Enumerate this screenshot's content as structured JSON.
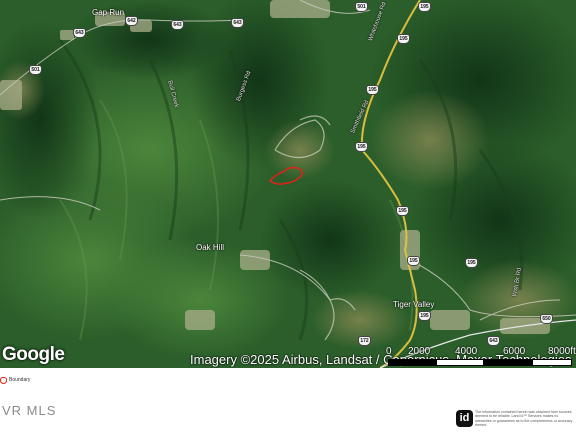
{
  "map": {
    "place_labels": [
      {
        "id": "gap-run",
        "text": "Gap Run"
      },
      {
        "id": "oak-hill",
        "text": "Oak Hill"
      },
      {
        "id": "tiger-valley",
        "text": "Tiger Valley"
      }
    ],
    "road_labels": [
      {
        "id": "whitehouse-rd",
        "text": "Whitehouse Rd"
      },
      {
        "id": "smithfield-rd",
        "text": "Smithfield Rd"
      },
      {
        "id": "bull-creek",
        "text": "Bull Creek"
      },
      {
        "id": "burgess-rd",
        "text": "Burgess Rd"
      },
      {
        "id": "wsh-br-rd",
        "text": "Wsh Br Rd"
      }
    ],
    "route_shields": [
      {
        "id": "s1",
        "text": "643"
      },
      {
        "id": "s2",
        "text": "642"
      },
      {
        "id": "s3",
        "text": "643"
      },
      {
        "id": "s4",
        "text": "643"
      },
      {
        "id": "s5",
        "text": "501"
      },
      {
        "id": "s6",
        "text": "501"
      },
      {
        "id": "s7",
        "text": "195"
      },
      {
        "id": "s8",
        "text": "195"
      },
      {
        "id": "s9",
        "text": "195"
      },
      {
        "id": "s10",
        "text": "195"
      },
      {
        "id": "s11",
        "text": "195"
      },
      {
        "id": "s12",
        "text": "195"
      },
      {
        "id": "s13",
        "text": "195"
      },
      {
        "id": "s14",
        "text": "195"
      },
      {
        "id": "s15",
        "text": "172"
      },
      {
        "id": "s16",
        "text": "643"
      },
      {
        "id": "s17",
        "text": "650"
      }
    ],
    "google_logo": "Google",
    "attribution": "Imagery ©2025 Airbus, Landsat / Copernicus, Maxar Technologies",
    "scale": {
      "labels": [
        "0",
        "2000",
        "4000",
        "6000",
        "8000ft"
      ]
    },
    "colors": {
      "forest_dark": "#1d4a22",
      "forest_mid": "#2f6b2d",
      "forest_light": "#4f8a3d",
      "clearing": "#9aa57a",
      "road_yellow": "#e3c240",
      "boundary": "#e0221a"
    }
  },
  "legend": {
    "label": "Boundary",
    "icon": "boundary-outline-icon"
  },
  "footer": {
    "brand": "VR MLS",
    "logo_text": "id",
    "disclaimer": "The information contained herein was obtained from sources deemed to be reliable. Land id™ Services makes no warranties or guarantees as to the completeness or accuracy thereof."
  }
}
